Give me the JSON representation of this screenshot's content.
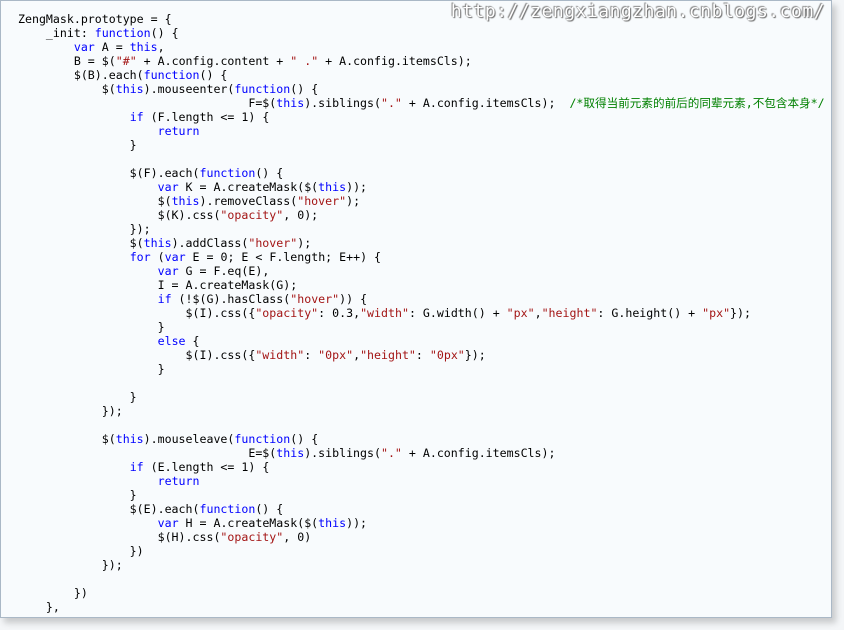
{
  "watermark": "http://zengxiangzhan.cnblogs.com/",
  "code_lines": [
    [
      [
        "ZengMask.prototype = {",
        "t"
      ]
    ],
    [
      [
        "    _init: ",
        "t"
      ],
      [
        "function",
        "kw"
      ],
      [
        "() {",
        "t"
      ]
    ],
    [
      [
        "        ",
        "t"
      ],
      [
        "var",
        "kw"
      ],
      [
        " A = ",
        "t"
      ],
      [
        "this",
        "kw"
      ],
      [
        ",",
        "t"
      ]
    ],
    [
      [
        "        B = $(",
        "t"
      ],
      [
        "\"#\"",
        "str"
      ],
      [
        " + A.config.content + ",
        "t"
      ],
      [
        "\" .\"",
        "str"
      ],
      [
        " + A.config.itemsCls);",
        "t"
      ]
    ],
    [
      [
        "        $(B).each(",
        "t"
      ],
      [
        "function",
        "kw"
      ],
      [
        "() {",
        "t"
      ]
    ],
    [
      [
        "            $(",
        "t"
      ],
      [
        "this",
        "kw"
      ],
      [
        ").mouseenter(",
        "t"
      ],
      [
        "function",
        "kw"
      ],
      [
        "() {",
        "t"
      ]
    ],
    [
      [
        "                                 F=$(",
        "t"
      ],
      [
        "this",
        "kw"
      ],
      [
        ").siblings(",
        "t"
      ],
      [
        "\".\"",
        "str"
      ],
      [
        " + A.config.itemsCls);  ",
        "t"
      ],
      [
        "/*取得当前元素的前后的同辈元素,不包含本身*/",
        "cmt"
      ]
    ],
    [
      [
        "                ",
        "t"
      ],
      [
        "if",
        "kw"
      ],
      [
        " (F.length <= ",
        "t"
      ],
      [
        "1",
        "num"
      ],
      [
        ") {",
        "t"
      ]
    ],
    [
      [
        "                    ",
        "t"
      ],
      [
        "return",
        "kw"
      ]
    ],
    [
      [
        "                }",
        "t"
      ]
    ],
    [
      [
        "",
        "t"
      ]
    ],
    [
      [
        "                $(F).each(",
        "t"
      ],
      [
        "function",
        "kw"
      ],
      [
        "() {",
        "t"
      ]
    ],
    [
      [
        "                    ",
        "t"
      ],
      [
        "var",
        "kw"
      ],
      [
        " K = A.createMask($(",
        "t"
      ],
      [
        "this",
        "kw"
      ],
      [
        "));",
        "t"
      ]
    ],
    [
      [
        "                    $(",
        "t"
      ],
      [
        "this",
        "kw"
      ],
      [
        ").removeClass(",
        "t"
      ],
      [
        "\"hover\"",
        "str"
      ],
      [
        ");",
        "t"
      ]
    ],
    [
      [
        "                    $(K).css(",
        "t"
      ],
      [
        "\"opacity\"",
        "str"
      ],
      [
        ", ",
        "t"
      ],
      [
        "0",
        "num"
      ],
      [
        ");",
        "t"
      ]
    ],
    [
      [
        "                });",
        "t"
      ]
    ],
    [
      [
        "                $(",
        "t"
      ],
      [
        "this",
        "kw"
      ],
      [
        ").addClass(",
        "t"
      ],
      [
        "\"hover\"",
        "str"
      ],
      [
        ");",
        "t"
      ]
    ],
    [
      [
        "                ",
        "t"
      ],
      [
        "for",
        "kw"
      ],
      [
        " (",
        "t"
      ],
      [
        "var",
        "kw"
      ],
      [
        " E = ",
        "t"
      ],
      [
        "0",
        "num"
      ],
      [
        "; E < F.length; E++) {",
        "t"
      ]
    ],
    [
      [
        "                    ",
        "t"
      ],
      [
        "var",
        "kw"
      ],
      [
        " G = F.eq(E),",
        "t"
      ]
    ],
    [
      [
        "                    I = A.createMask(G);",
        "t"
      ]
    ],
    [
      [
        "                    ",
        "t"
      ],
      [
        "if",
        "kw"
      ],
      [
        " (!$(G).hasClass(",
        "t"
      ],
      [
        "\"hover\"",
        "str"
      ],
      [
        ")) {",
        "t"
      ]
    ],
    [
      [
        "                        $(I).css({",
        "t"
      ],
      [
        "\"opacity\"",
        "str"
      ],
      [
        ": ",
        "t"
      ],
      [
        "0.3",
        "num"
      ],
      [
        ",",
        "t"
      ],
      [
        "\"width\"",
        "str"
      ],
      [
        ": G.width() + ",
        "t"
      ],
      [
        "\"px\"",
        "str"
      ],
      [
        ",",
        "t"
      ],
      [
        "\"height\"",
        "str"
      ],
      [
        ": G.height() + ",
        "t"
      ],
      [
        "\"px\"",
        "str"
      ],
      [
        "});",
        "t"
      ]
    ],
    [
      [
        "                    }",
        "t"
      ]
    ],
    [
      [
        "                    ",
        "t"
      ],
      [
        "else",
        "kw"
      ],
      [
        " {",
        "t"
      ]
    ],
    [
      [
        "                        $(I).css({",
        "t"
      ],
      [
        "\"width\"",
        "str"
      ],
      [
        ": ",
        "t"
      ],
      [
        "\"0px\"",
        "str"
      ],
      [
        ",",
        "t"
      ],
      [
        "\"height\"",
        "str"
      ],
      [
        ": ",
        "t"
      ],
      [
        "\"0px\"",
        "str"
      ],
      [
        "});",
        "t"
      ]
    ],
    [
      [
        "                    }",
        "t"
      ]
    ],
    [
      [
        "",
        "t"
      ]
    ],
    [
      [
        "                }",
        "t"
      ]
    ],
    [
      [
        "            });",
        "t"
      ]
    ],
    [
      [
        "",
        "t"
      ]
    ],
    [
      [
        "            $(",
        "t"
      ],
      [
        "this",
        "kw"
      ],
      [
        ").mouseleave(",
        "t"
      ],
      [
        "function",
        "kw"
      ],
      [
        "() {",
        "t"
      ]
    ],
    [
      [
        "                                 E=$(",
        "t"
      ],
      [
        "this",
        "kw"
      ],
      [
        ").siblings(",
        "t"
      ],
      [
        "\".\"",
        "str"
      ],
      [
        " + A.config.itemsCls);",
        "t"
      ]
    ],
    [
      [
        "                ",
        "t"
      ],
      [
        "if",
        "kw"
      ],
      [
        " (E.length <= ",
        "t"
      ],
      [
        "1",
        "num"
      ],
      [
        ") {",
        "t"
      ]
    ],
    [
      [
        "                    ",
        "t"
      ],
      [
        "return",
        "kw"
      ]
    ],
    [
      [
        "                }",
        "t"
      ]
    ],
    [
      [
        "                $(E).each(",
        "t"
      ],
      [
        "function",
        "kw"
      ],
      [
        "() {",
        "t"
      ]
    ],
    [
      [
        "                    ",
        "t"
      ],
      [
        "var",
        "kw"
      ],
      [
        " H = A.createMask($(",
        "t"
      ],
      [
        "this",
        "kw"
      ],
      [
        "));",
        "t"
      ]
    ],
    [
      [
        "                    $(H).css(",
        "t"
      ],
      [
        "\"opacity\"",
        "str"
      ],
      [
        ", ",
        "t"
      ],
      [
        "0",
        "num"
      ],
      [
        ")",
        "t"
      ]
    ],
    [
      [
        "                })",
        "t"
      ]
    ],
    [
      [
        "            });",
        "t"
      ]
    ],
    [
      [
        "",
        "t"
      ]
    ],
    [
      [
        "        })",
        "t"
      ]
    ],
    [
      [
        "    },",
        "t"
      ]
    ]
  ],
  "colors": {
    "keyword": "#0000ff",
    "string": "#a31515",
    "comment": "#008000",
    "text": "#000000",
    "background": "#f8fbfd"
  }
}
